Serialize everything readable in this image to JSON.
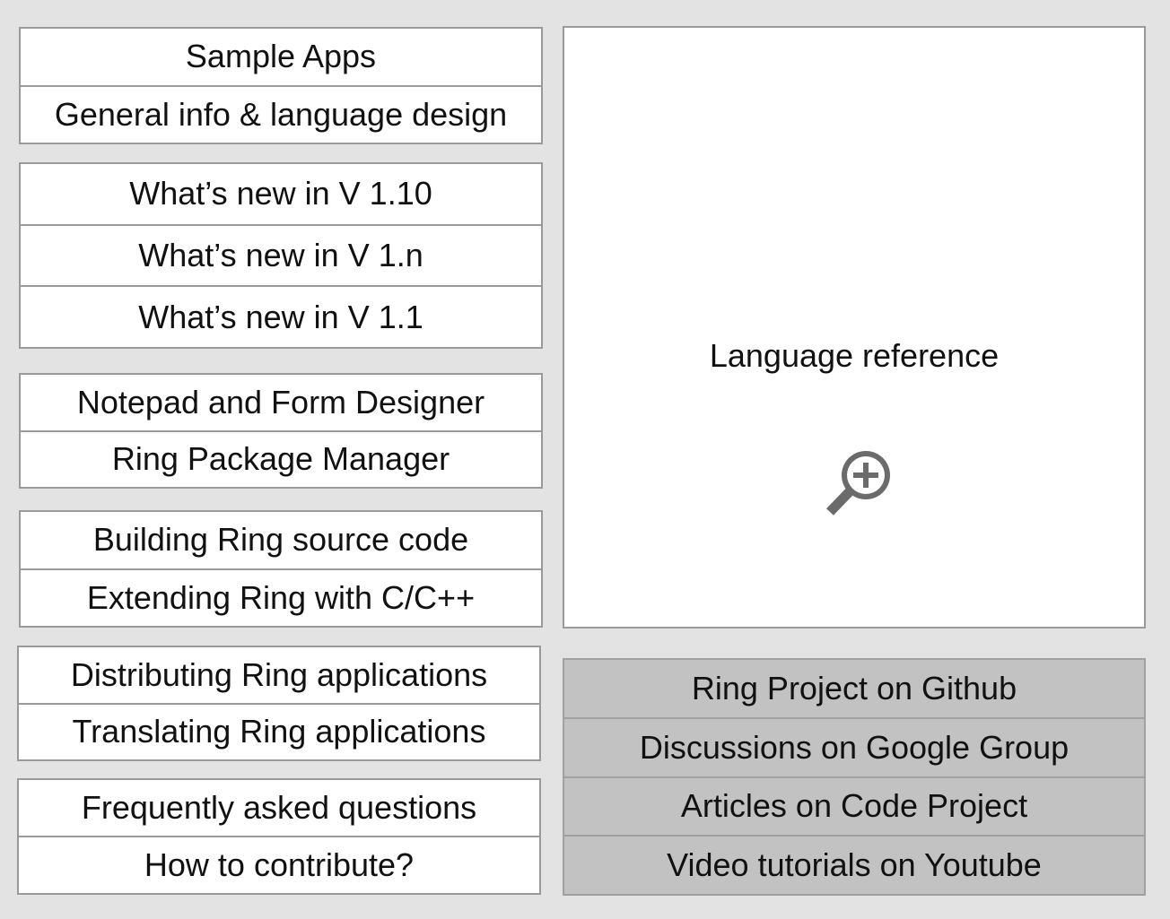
{
  "left_groups": [
    {
      "items": [
        "Sample Apps",
        "General info & language design"
      ]
    },
    {
      "items": [
        "What’s new in V 1.10",
        "What’s new in V 1.n",
        "What’s new in V 1.1"
      ]
    },
    {
      "items": [
        "Notepad and Form Designer",
        "Ring Package Manager"
      ]
    },
    {
      "items": [
        "Building Ring source code",
        "Extending Ring with C/C++"
      ]
    },
    {
      "items": [
        "Distributing Ring applications",
        "Translating Ring applications"
      ]
    },
    {
      "items": [
        "Frequently asked questions",
        "How to contribute?"
      ]
    }
  ],
  "reference_panel": {
    "title": "Language reference",
    "icon": "zoom-in-icon"
  },
  "external_links": {
    "items": [
      "Ring Project on Github",
      "Discussions on Google Group",
      "Articles on Code Project",
      "Video tutorials on Youtube"
    ]
  },
  "colors": {
    "page_background": "#e3e3e3",
    "panel_background": "#ffffff",
    "external_links_background": "#c2c2c2",
    "border": "#9a9a9a",
    "icon": "#6b6b6b"
  }
}
